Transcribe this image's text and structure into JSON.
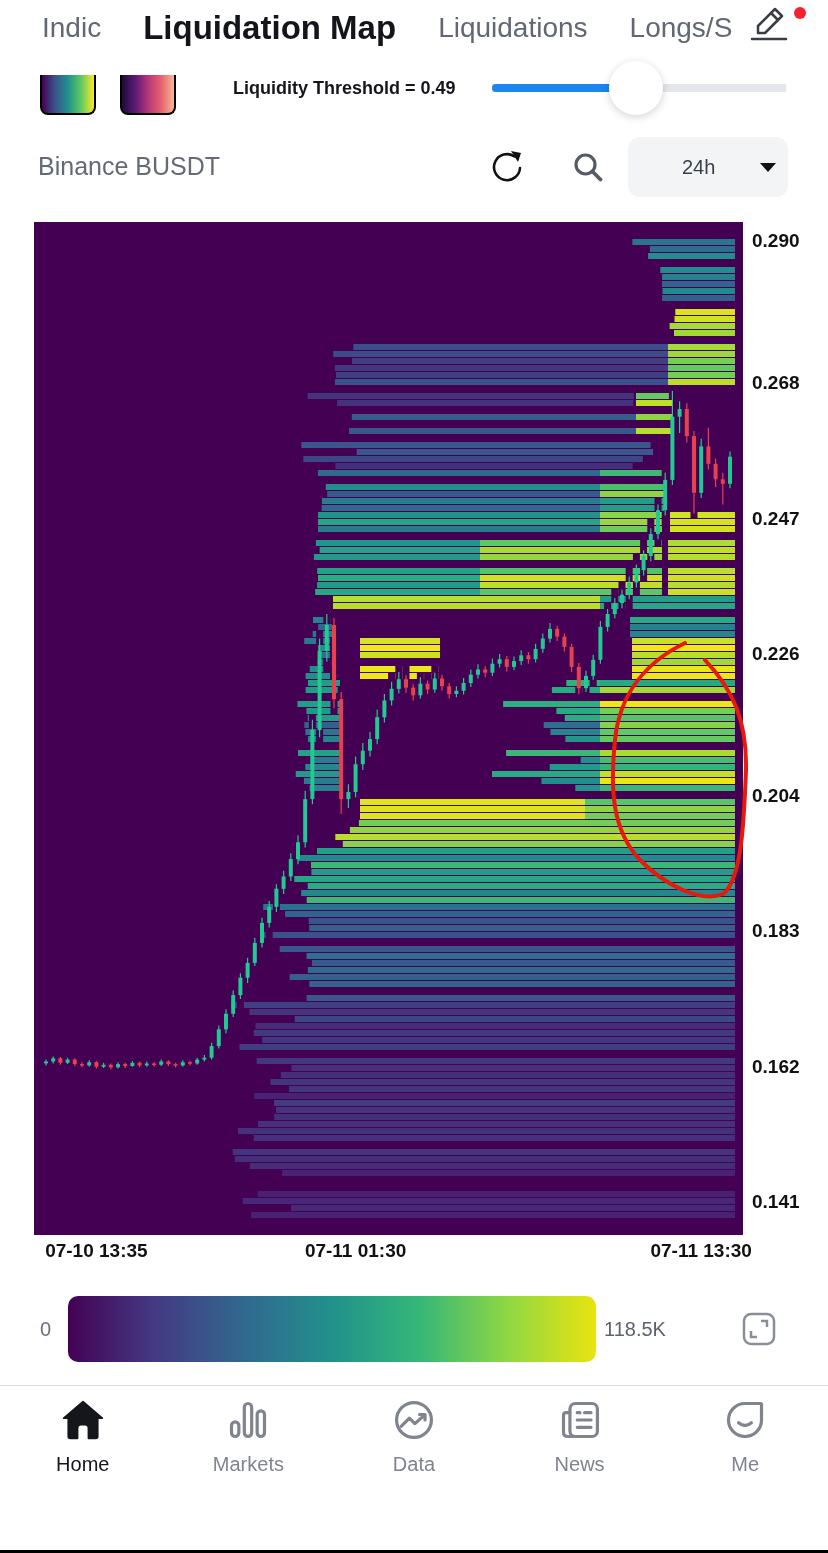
{
  "tabs": [
    {
      "label": "Indic",
      "selected": false
    },
    {
      "label": "Liquidation Map",
      "selected": true
    },
    {
      "label": "Liquidations",
      "selected": false
    },
    {
      "label": "Longs/S",
      "selected": false
    }
  ],
  "edit_button": {
    "notification": true
  },
  "threshold_slider": {
    "label": "Liquidity Threshold = 0.49",
    "level": 0.49
  },
  "market": {
    "name": "Binance BUSDT",
    "period": "24h"
  },
  "chart": {
    "chart_data": {
      "type": "candlestick",
      "categories": [
        null,
        null,
        null,
        null,
        null,
        null,
        null,
        "07-10 13:35",
        null,
        null,
        null,
        null,
        null,
        null,
        null,
        null,
        null,
        null,
        null,
        null,
        null,
        null,
        null,
        null,
        null,
        null,
        null,
        null,
        null,
        null,
        null,
        null,
        null,
        null,
        null,
        null,
        null,
        null,
        null,
        null,
        null,
        null,
        null,
        "07-11 01:30",
        null,
        null,
        null,
        null,
        null,
        null,
        null,
        null,
        null,
        null,
        null,
        null,
        null,
        null,
        null,
        null,
        null,
        null,
        null,
        null,
        null,
        null,
        null,
        null,
        null,
        null,
        null,
        null,
        null,
        null,
        null,
        null,
        null,
        null,
        null,
        null,
        null,
        null,
        null,
        null,
        null,
        null,
        null,
        null,
        null,
        null,
        null,
        "07-11 13:30",
        null,
        null,
        null,
        null
      ],
      "ohlc": [
        [
          0.1625,
          0.1631,
          0.1622,
          0.1628
        ],
        [
          0.1628,
          0.1636,
          0.1625,
          0.1633
        ],
        [
          0.1633,
          0.1635,
          0.1623,
          0.1626
        ],
        [
          0.1626,
          0.1634,
          0.1624,
          0.1631
        ],
        [
          0.1631,
          0.1633,
          0.1621,
          0.1624
        ],
        [
          0.1624,
          0.1627,
          0.1619,
          0.1622
        ],
        [
          0.1622,
          0.163,
          0.162,
          0.1627
        ],
        [
          0.1627,
          0.1629,
          0.1617,
          0.162
        ],
        [
          0.162,
          0.1626,
          0.1618,
          0.1623
        ],
        [
          0.1623,
          0.1625,
          0.1616,
          0.1619
        ],
        [
          0.1619,
          0.1627,
          0.1617,
          0.1624
        ],
        [
          0.1624,
          0.1626,
          0.1618,
          0.1621
        ],
        [
          0.1621,
          0.1629,
          0.162,
          0.1626
        ],
        [
          0.1626,
          0.1628,
          0.1619,
          0.1622
        ],
        [
          0.1622,
          0.1628,
          0.162,
          0.1625
        ],
        [
          0.1625,
          0.1627,
          0.162,
          0.1623
        ],
        [
          0.1623,
          0.1631,
          0.1621,
          0.1628
        ],
        [
          0.1628,
          0.163,
          0.1621,
          0.1624
        ],
        [
          0.1624,
          0.1626,
          0.1619,
          0.1622
        ],
        [
          0.1622,
          0.163,
          0.162,
          0.1627
        ],
        [
          0.1627,
          0.1629,
          0.1622,
          0.1625
        ],
        [
          0.1625,
          0.1634,
          0.1623,
          0.1631
        ],
        [
          0.1631,
          0.1638,
          0.1628,
          0.1634
        ],
        [
          0.1634,
          0.1657,
          0.1631,
          0.1652
        ],
        [
          0.1652,
          0.1684,
          0.1648,
          0.1678
        ],
        [
          0.1678,
          0.1709,
          0.1672,
          0.1702
        ],
        [
          0.1702,
          0.1738,
          0.1697,
          0.1731
        ],
        [
          0.1731,
          0.1765,
          0.1725,
          0.1758
        ],
        [
          0.1758,
          0.1789,
          0.175,
          0.1781
        ],
        [
          0.1781,
          0.182,
          0.1776,
          0.1812
        ],
        [
          0.1812,
          0.1851,
          0.1805,
          0.1843
        ],
        [
          0.1843,
          0.1877,
          0.1836,
          0.1868
        ],
        [
          0.1868,
          0.1903,
          0.186,
          0.1896
        ],
        [
          0.1896,
          0.1924,
          0.1888,
          0.1915
        ],
        [
          0.1915,
          0.1951,
          0.1908,
          0.1942
        ],
        [
          0.1942,
          0.1979,
          0.1934,
          0.1968
        ],
        [
          0.1968,
          0.2048,
          0.196,
          0.2035
        ],
        [
          0.2035,
          0.2158,
          0.2027,
          0.2142
        ],
        [
          0.2142,
          0.2284,
          0.2131,
          0.2265
        ],
        [
          0.2265,
          0.2322,
          0.2248,
          0.2305
        ],
        [
          0.2305,
          0.2316,
          0.2176,
          0.219
        ],
        [
          0.219,
          0.2201,
          0.2012,
          0.2035
        ],
        [
          0.2035,
          0.2058,
          0.2021,
          0.2046
        ],
        [
          0.2046,
          0.2101,
          0.2038,
          0.2089
        ],
        [
          0.2089,
          0.2122,
          0.208,
          0.211
        ],
        [
          0.211,
          0.2139,
          0.2101,
          0.2128
        ],
        [
          0.2128,
          0.2174,
          0.212,
          0.2162
        ],
        [
          0.2162,
          0.2198,
          0.2154,
          0.2188
        ],
        [
          0.2188,
          0.2217,
          0.218,
          0.2206
        ],
        [
          0.2206,
          0.2232,
          0.2199,
          0.2221
        ],
        [
          0.2221,
          0.2227,
          0.22,
          0.2208
        ],
        [
          0.2208,
          0.2213,
          0.2188,
          0.2196
        ],
        [
          0.2196,
          0.2224,
          0.2191,
          0.2214
        ],
        [
          0.2214,
          0.2219,
          0.2198,
          0.2205
        ],
        [
          0.2205,
          0.2231,
          0.22,
          0.2222
        ],
        [
          0.2222,
          0.2228,
          0.2203,
          0.221
        ],
        [
          0.221,
          0.2215,
          0.2191,
          0.2198
        ],
        [
          0.2198,
          0.221,
          0.2193,
          0.2203
        ],
        [
          0.2203,
          0.2223,
          0.2197,
          0.2215
        ],
        [
          0.2215,
          0.2236,
          0.2209,
          0.2228
        ],
        [
          0.2228,
          0.2244,
          0.2222,
          0.2236
        ],
        [
          0.2236,
          0.2241,
          0.2224,
          0.2231
        ],
        [
          0.2231,
          0.2253,
          0.2226,
          0.2245
        ],
        [
          0.2245,
          0.226,
          0.2239,
          0.2252
        ],
        [
          0.2252,
          0.2257,
          0.2233,
          0.224
        ],
        [
          0.224,
          0.2256,
          0.2235,
          0.2249
        ],
        [
          0.2249,
          0.2266,
          0.2243,
          0.2258
        ],
        [
          0.2258,
          0.2263,
          0.2245,
          0.2252
        ],
        [
          0.2252,
          0.2276,
          0.2247,
          0.2268
        ],
        [
          0.2268,
          0.2292,
          0.2262,
          0.2284
        ],
        [
          0.2284,
          0.2308,
          0.2278,
          0.2299
        ],
        [
          0.2299,
          0.2304,
          0.228,
          0.2287
        ],
        [
          0.2287,
          0.2292,
          0.2264,
          0.2271
        ],
        [
          0.2271,
          0.2276,
          0.2232,
          0.224
        ],
        [
          0.224,
          0.2246,
          0.2198,
          0.2207
        ],
        [
          0.2207,
          0.2234,
          0.2201,
          0.2226
        ],
        [
          0.2226,
          0.2259,
          0.222,
          0.2251
        ],
        [
          0.2251,
          0.2311,
          0.2245,
          0.2302
        ],
        [
          0.2302,
          0.233,
          0.2295,
          0.2322
        ],
        [
          0.2322,
          0.2347,
          0.2315,
          0.2339
        ],
        [
          0.2339,
          0.236,
          0.2331,
          0.2352
        ],
        [
          0.2352,
          0.238,
          0.2345,
          0.2371
        ],
        [
          0.2371,
          0.2399,
          0.2363,
          0.239
        ],
        [
          0.239,
          0.2421,
          0.2382,
          0.2412
        ],
        [
          0.2412,
          0.2455,
          0.2404,
          0.2446
        ],
        [
          0.2446,
          0.2492,
          0.2438,
          0.2483
        ],
        [
          0.2483,
          0.2541,
          0.2475,
          0.253
        ],
        [
          0.253,
          0.2668,
          0.2522,
          0.2628
        ],
        [
          0.2628,
          0.2652,
          0.2603,
          0.264
        ],
        [
          0.264,
          0.2649,
          0.2588,
          0.2598
        ],
        [
          0.2598,
          0.2606,
          0.2478,
          0.251
        ],
        [
          0.251,
          0.2594,
          0.2502,
          0.2582
        ],
        [
          0.2582,
          0.2611,
          0.2546,
          0.2555
        ],
        [
          0.2555,
          0.2563,
          0.2519,
          0.2531
        ],
        [
          0.2531,
          0.2541,
          0.2492,
          0.2524
        ],
        [
          0.2524,
          0.2574,
          0.2517,
          0.2566
        ]
      ],
      "ylim": [
        0.1359,
        0.293
      ],
      "yticks": [
        {
          "value": 0.29,
          "label": "0.290"
        },
        {
          "value": 0.268,
          "label": "0.268"
        },
        {
          "value": 0.247,
          "label": "0.247"
        },
        {
          "value": 0.226,
          "label": "0.226"
        },
        {
          "value": 0.204,
          "label": "0.204"
        },
        {
          "value": 0.183,
          "label": "0.183"
        },
        {
          "value": 0.162,
          "label": "0.162"
        },
        {
          "value": 0.141,
          "label": "0.141"
        }
      ]
    }
  },
  "color_scale": {
    "min_label": "0",
    "max_label": "118.5K"
  },
  "bottom_nav": [
    {
      "label": "Home",
      "selected": true
    },
    {
      "label": "Markets",
      "selected": false
    },
    {
      "label": "Data",
      "selected": false
    },
    {
      "label": "News",
      "selected": false
    },
    {
      "label": "Me",
      "selected": false
    }
  ]
}
